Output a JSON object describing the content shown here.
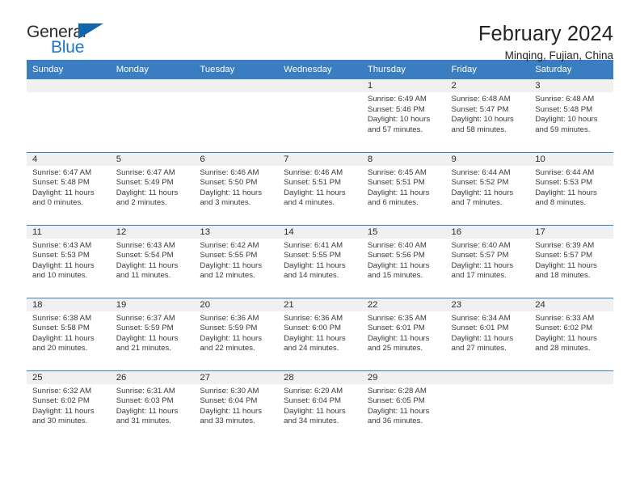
{
  "logo": {
    "word_top": "General",
    "word_bottom": "Blue",
    "triangle_icon": "blue-triangle-icon"
  },
  "header": {
    "title": "February 2024",
    "subtitle": "Minqing, Fujian, China"
  },
  "theme": {
    "header_blue": "#3a7dc0",
    "daynum_strip": "#f0f0f0",
    "text": "#3a3a3a",
    "logo_blue": "#1f77c4"
  },
  "weekdays": [
    "Sunday",
    "Monday",
    "Tuesday",
    "Wednesday",
    "Thursday",
    "Friday",
    "Saturday"
  ],
  "labels": {
    "sunrise": "Sunrise:",
    "sunset": "Sunset:",
    "daylight": "Daylight:"
  },
  "weeks": [
    [
      {
        "day": "",
        "empty": true
      },
      {
        "day": "",
        "empty": true
      },
      {
        "day": "",
        "empty": true
      },
      {
        "day": "",
        "empty": true
      },
      {
        "day": "1",
        "sunrise": "Sunrise: 6:49 AM",
        "sunset": "Sunset: 5:46 PM",
        "daylight1": "Daylight: 10 hours",
        "daylight2": "and 57 minutes."
      },
      {
        "day": "2",
        "sunrise": "Sunrise: 6:48 AM",
        "sunset": "Sunset: 5:47 PM",
        "daylight1": "Daylight: 10 hours",
        "daylight2": "and 58 minutes."
      },
      {
        "day": "3",
        "sunrise": "Sunrise: 6:48 AM",
        "sunset": "Sunset: 5:48 PM",
        "daylight1": "Daylight: 10 hours",
        "daylight2": "and 59 minutes."
      }
    ],
    [
      {
        "day": "4",
        "sunrise": "Sunrise: 6:47 AM",
        "sunset": "Sunset: 5:48 PM",
        "daylight1": "Daylight: 11 hours",
        "daylight2": "and 0 minutes."
      },
      {
        "day": "5",
        "sunrise": "Sunrise: 6:47 AM",
        "sunset": "Sunset: 5:49 PM",
        "daylight1": "Daylight: 11 hours",
        "daylight2": "and 2 minutes."
      },
      {
        "day": "6",
        "sunrise": "Sunrise: 6:46 AM",
        "sunset": "Sunset: 5:50 PM",
        "daylight1": "Daylight: 11 hours",
        "daylight2": "and 3 minutes."
      },
      {
        "day": "7",
        "sunrise": "Sunrise: 6:46 AM",
        "sunset": "Sunset: 5:51 PM",
        "daylight1": "Daylight: 11 hours",
        "daylight2": "and 4 minutes."
      },
      {
        "day": "8",
        "sunrise": "Sunrise: 6:45 AM",
        "sunset": "Sunset: 5:51 PM",
        "daylight1": "Daylight: 11 hours",
        "daylight2": "and 6 minutes."
      },
      {
        "day": "9",
        "sunrise": "Sunrise: 6:44 AM",
        "sunset": "Sunset: 5:52 PM",
        "daylight1": "Daylight: 11 hours",
        "daylight2": "and 7 minutes."
      },
      {
        "day": "10",
        "sunrise": "Sunrise: 6:44 AM",
        "sunset": "Sunset: 5:53 PM",
        "daylight1": "Daylight: 11 hours",
        "daylight2": "and 8 minutes."
      }
    ],
    [
      {
        "day": "11",
        "sunrise": "Sunrise: 6:43 AM",
        "sunset": "Sunset: 5:53 PM",
        "daylight1": "Daylight: 11 hours",
        "daylight2": "and 10 minutes."
      },
      {
        "day": "12",
        "sunrise": "Sunrise: 6:43 AM",
        "sunset": "Sunset: 5:54 PM",
        "daylight1": "Daylight: 11 hours",
        "daylight2": "and 11 minutes."
      },
      {
        "day": "13",
        "sunrise": "Sunrise: 6:42 AM",
        "sunset": "Sunset: 5:55 PM",
        "daylight1": "Daylight: 11 hours",
        "daylight2": "and 12 minutes."
      },
      {
        "day": "14",
        "sunrise": "Sunrise: 6:41 AM",
        "sunset": "Sunset: 5:55 PM",
        "daylight1": "Daylight: 11 hours",
        "daylight2": "and 14 minutes."
      },
      {
        "day": "15",
        "sunrise": "Sunrise: 6:40 AM",
        "sunset": "Sunset: 5:56 PM",
        "daylight1": "Daylight: 11 hours",
        "daylight2": "and 15 minutes."
      },
      {
        "day": "16",
        "sunrise": "Sunrise: 6:40 AM",
        "sunset": "Sunset: 5:57 PM",
        "daylight1": "Daylight: 11 hours",
        "daylight2": "and 17 minutes."
      },
      {
        "day": "17",
        "sunrise": "Sunrise: 6:39 AM",
        "sunset": "Sunset: 5:57 PM",
        "daylight1": "Daylight: 11 hours",
        "daylight2": "and 18 minutes."
      }
    ],
    [
      {
        "day": "18",
        "sunrise": "Sunrise: 6:38 AM",
        "sunset": "Sunset: 5:58 PM",
        "daylight1": "Daylight: 11 hours",
        "daylight2": "and 20 minutes."
      },
      {
        "day": "19",
        "sunrise": "Sunrise: 6:37 AM",
        "sunset": "Sunset: 5:59 PM",
        "daylight1": "Daylight: 11 hours",
        "daylight2": "and 21 minutes."
      },
      {
        "day": "20",
        "sunrise": "Sunrise: 6:36 AM",
        "sunset": "Sunset: 5:59 PM",
        "daylight1": "Daylight: 11 hours",
        "daylight2": "and 22 minutes."
      },
      {
        "day": "21",
        "sunrise": "Sunrise: 6:36 AM",
        "sunset": "Sunset: 6:00 PM",
        "daylight1": "Daylight: 11 hours",
        "daylight2": "and 24 minutes."
      },
      {
        "day": "22",
        "sunrise": "Sunrise: 6:35 AM",
        "sunset": "Sunset: 6:01 PM",
        "daylight1": "Daylight: 11 hours",
        "daylight2": "and 25 minutes."
      },
      {
        "day": "23",
        "sunrise": "Sunrise: 6:34 AM",
        "sunset": "Sunset: 6:01 PM",
        "daylight1": "Daylight: 11 hours",
        "daylight2": "and 27 minutes."
      },
      {
        "day": "24",
        "sunrise": "Sunrise: 6:33 AM",
        "sunset": "Sunset: 6:02 PM",
        "daylight1": "Daylight: 11 hours",
        "daylight2": "and 28 minutes."
      }
    ],
    [
      {
        "day": "25",
        "sunrise": "Sunrise: 6:32 AM",
        "sunset": "Sunset: 6:02 PM",
        "daylight1": "Daylight: 11 hours",
        "daylight2": "and 30 minutes."
      },
      {
        "day": "26",
        "sunrise": "Sunrise: 6:31 AM",
        "sunset": "Sunset: 6:03 PM",
        "daylight1": "Daylight: 11 hours",
        "daylight2": "and 31 minutes."
      },
      {
        "day": "27",
        "sunrise": "Sunrise: 6:30 AM",
        "sunset": "Sunset: 6:04 PM",
        "daylight1": "Daylight: 11 hours",
        "daylight2": "and 33 minutes."
      },
      {
        "day": "28",
        "sunrise": "Sunrise: 6:29 AM",
        "sunset": "Sunset: 6:04 PM",
        "daylight1": "Daylight: 11 hours",
        "daylight2": "and 34 minutes."
      },
      {
        "day": "29",
        "sunrise": "Sunrise: 6:28 AM",
        "sunset": "Sunset: 6:05 PM",
        "daylight1": "Daylight: 11 hours",
        "daylight2": "and 36 minutes."
      },
      {
        "day": "",
        "empty": true
      },
      {
        "day": "",
        "empty": true
      }
    ]
  ]
}
